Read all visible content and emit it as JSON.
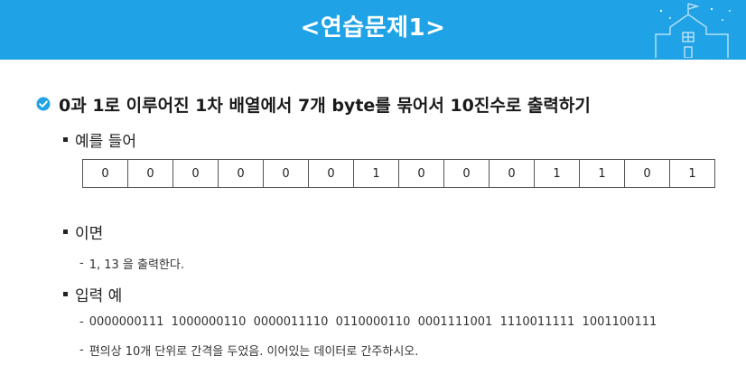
{
  "header": {
    "title": "<연습문제1>"
  },
  "main": {
    "text": "0과 1로 이루어진 1차 배열에서 7개 byte를 묶어서 10진수로 출력하기"
  },
  "example": {
    "label": "예를 들어",
    "bits": [
      "0",
      "0",
      "0",
      "0",
      "0",
      "0",
      "1",
      "0",
      "0",
      "0",
      "1",
      "1",
      "0",
      "1"
    ]
  },
  "then": {
    "label": "이면",
    "dash": "-",
    "text": "1, 13 을 출력한다."
  },
  "input_example": {
    "label": "입력 예",
    "dash": "-",
    "line1": "0000000111  1000000110  0000011110  0110000110  0001111001  1110011111  1001100111",
    "line2": "편의상 10개 단위로 간격을 두었음. 이어있는 데이터로 간주하시오."
  },
  "colors": {
    "header": "#1fa3e6",
    "check": "#1fa3e6"
  },
  "icons": {
    "check": "check-circle-icon",
    "school": "school-building-icon"
  }
}
